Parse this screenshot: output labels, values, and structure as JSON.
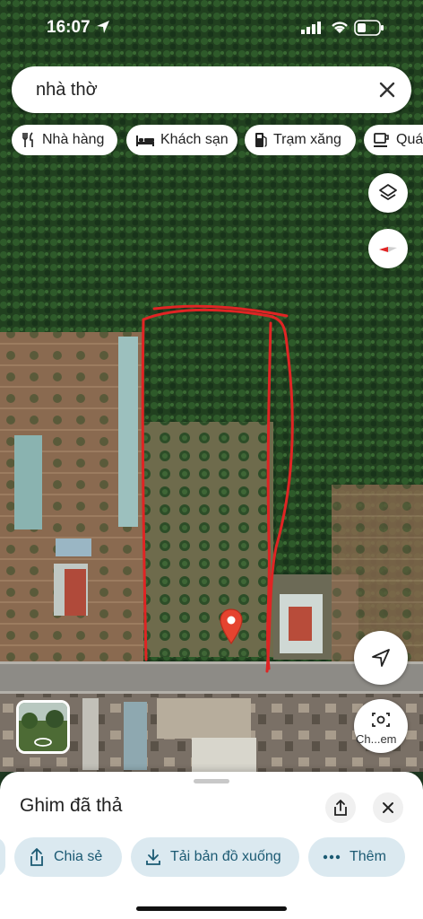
{
  "status_bar": {
    "time": "16:07"
  },
  "search": {
    "query": "nhà thờ"
  },
  "chips": [
    {
      "label": "Nhà hàng",
      "icon": "fork-knife-icon"
    },
    {
      "label": "Khách sạn",
      "icon": "bed-icon"
    },
    {
      "label": "Trạm xăng",
      "icon": "gas-pump-icon"
    },
    {
      "label": "Quá",
      "icon": "coffee-cup-icon"
    }
  ],
  "map": {
    "view": "satellite",
    "dropped_pin_color": "#e5432f",
    "annotation_color": "#e02424",
    "street_view_label": "Ch...em"
  },
  "sheet": {
    "title": "Ghim đã thả",
    "actions": [
      {
        "label": "Chia sẻ",
        "icon": "share-icon"
      },
      {
        "label": "Tải bản đồ xuống",
        "icon": "download-icon"
      },
      {
        "label": "Thêm",
        "icon": "more-dots-icon"
      }
    ]
  }
}
